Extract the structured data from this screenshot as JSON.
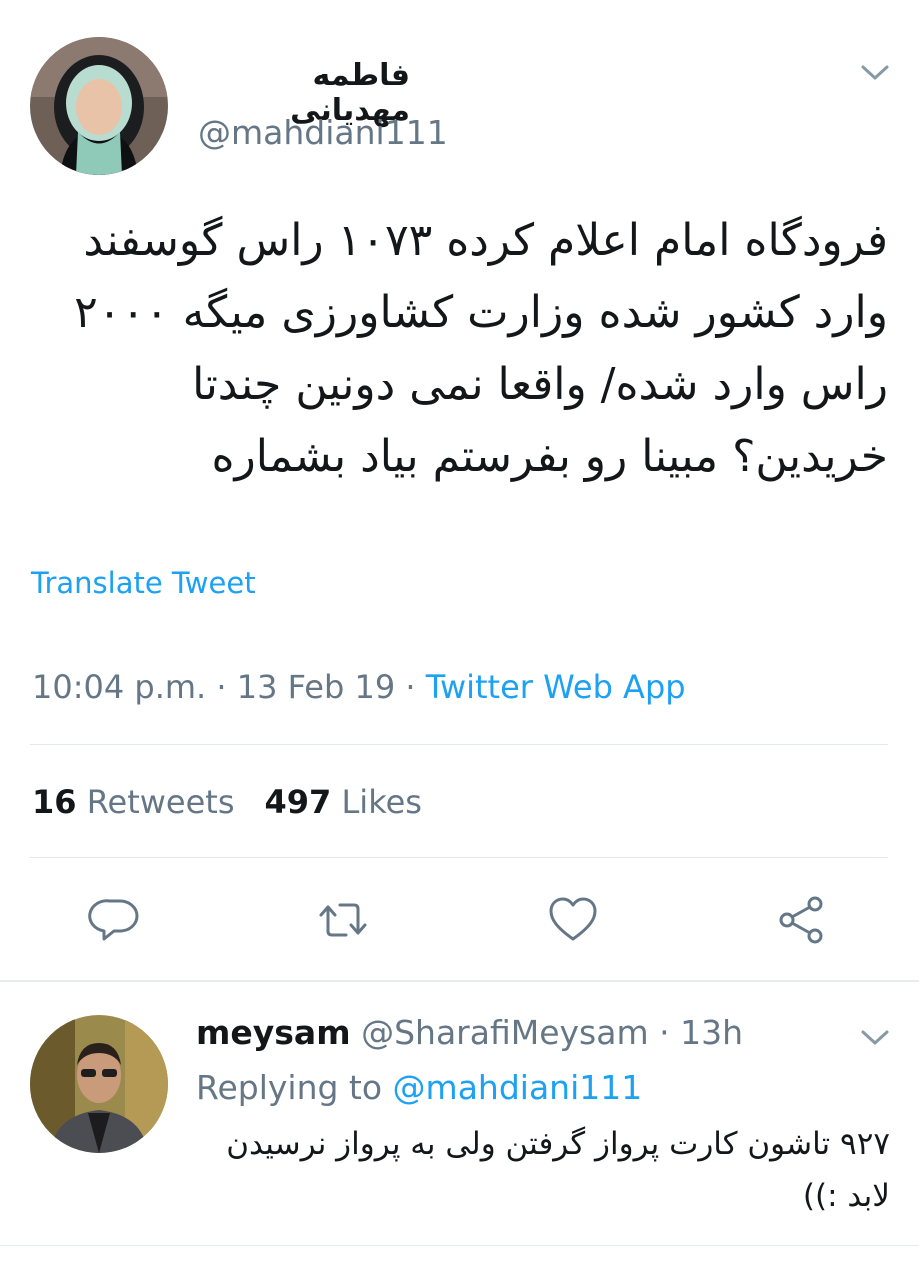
{
  "tweet": {
    "author_name": "فاطمه مهدیانی",
    "author_handle": "@mahdiani111",
    "text": "فرودگاه امام اعلام کرده ۱۰۷۳ راس گوسفند وارد کشور شده وزارت کشاورزی میگه ۲۰۰۰ راس وارد شده/ واقعا نمی دونین چندتا خریدین؟ مبینا رو بفرستم بیاد بشماره",
    "translate_label": "Translate Tweet",
    "time": "10:04 p.m.",
    "date": "13 Feb 19",
    "separator": "·",
    "source": "Twitter Web App",
    "retweets_count": "16",
    "retweets_label": "Retweets",
    "likes_count": "497",
    "likes_label": "Likes"
  },
  "actions": {
    "reply_icon": "reply-icon",
    "retweet_icon": "retweet-icon",
    "like_icon": "heart-icon",
    "share_icon": "share-icon"
  },
  "reply": {
    "name": "meysam",
    "handle": "@SharafiMeysam",
    "separator": "·",
    "time": "13h",
    "replying_prefix": "Replying to",
    "replying_handle": "@mahdiani111",
    "text": "۹۲۷ تاشون کارت پرواز گرفتن ولی به پرواز نرسیدن لابد :))"
  },
  "colors": {
    "accent": "#1da1f2",
    "secondary_text": "#657786",
    "primary_text": "#14171a"
  }
}
